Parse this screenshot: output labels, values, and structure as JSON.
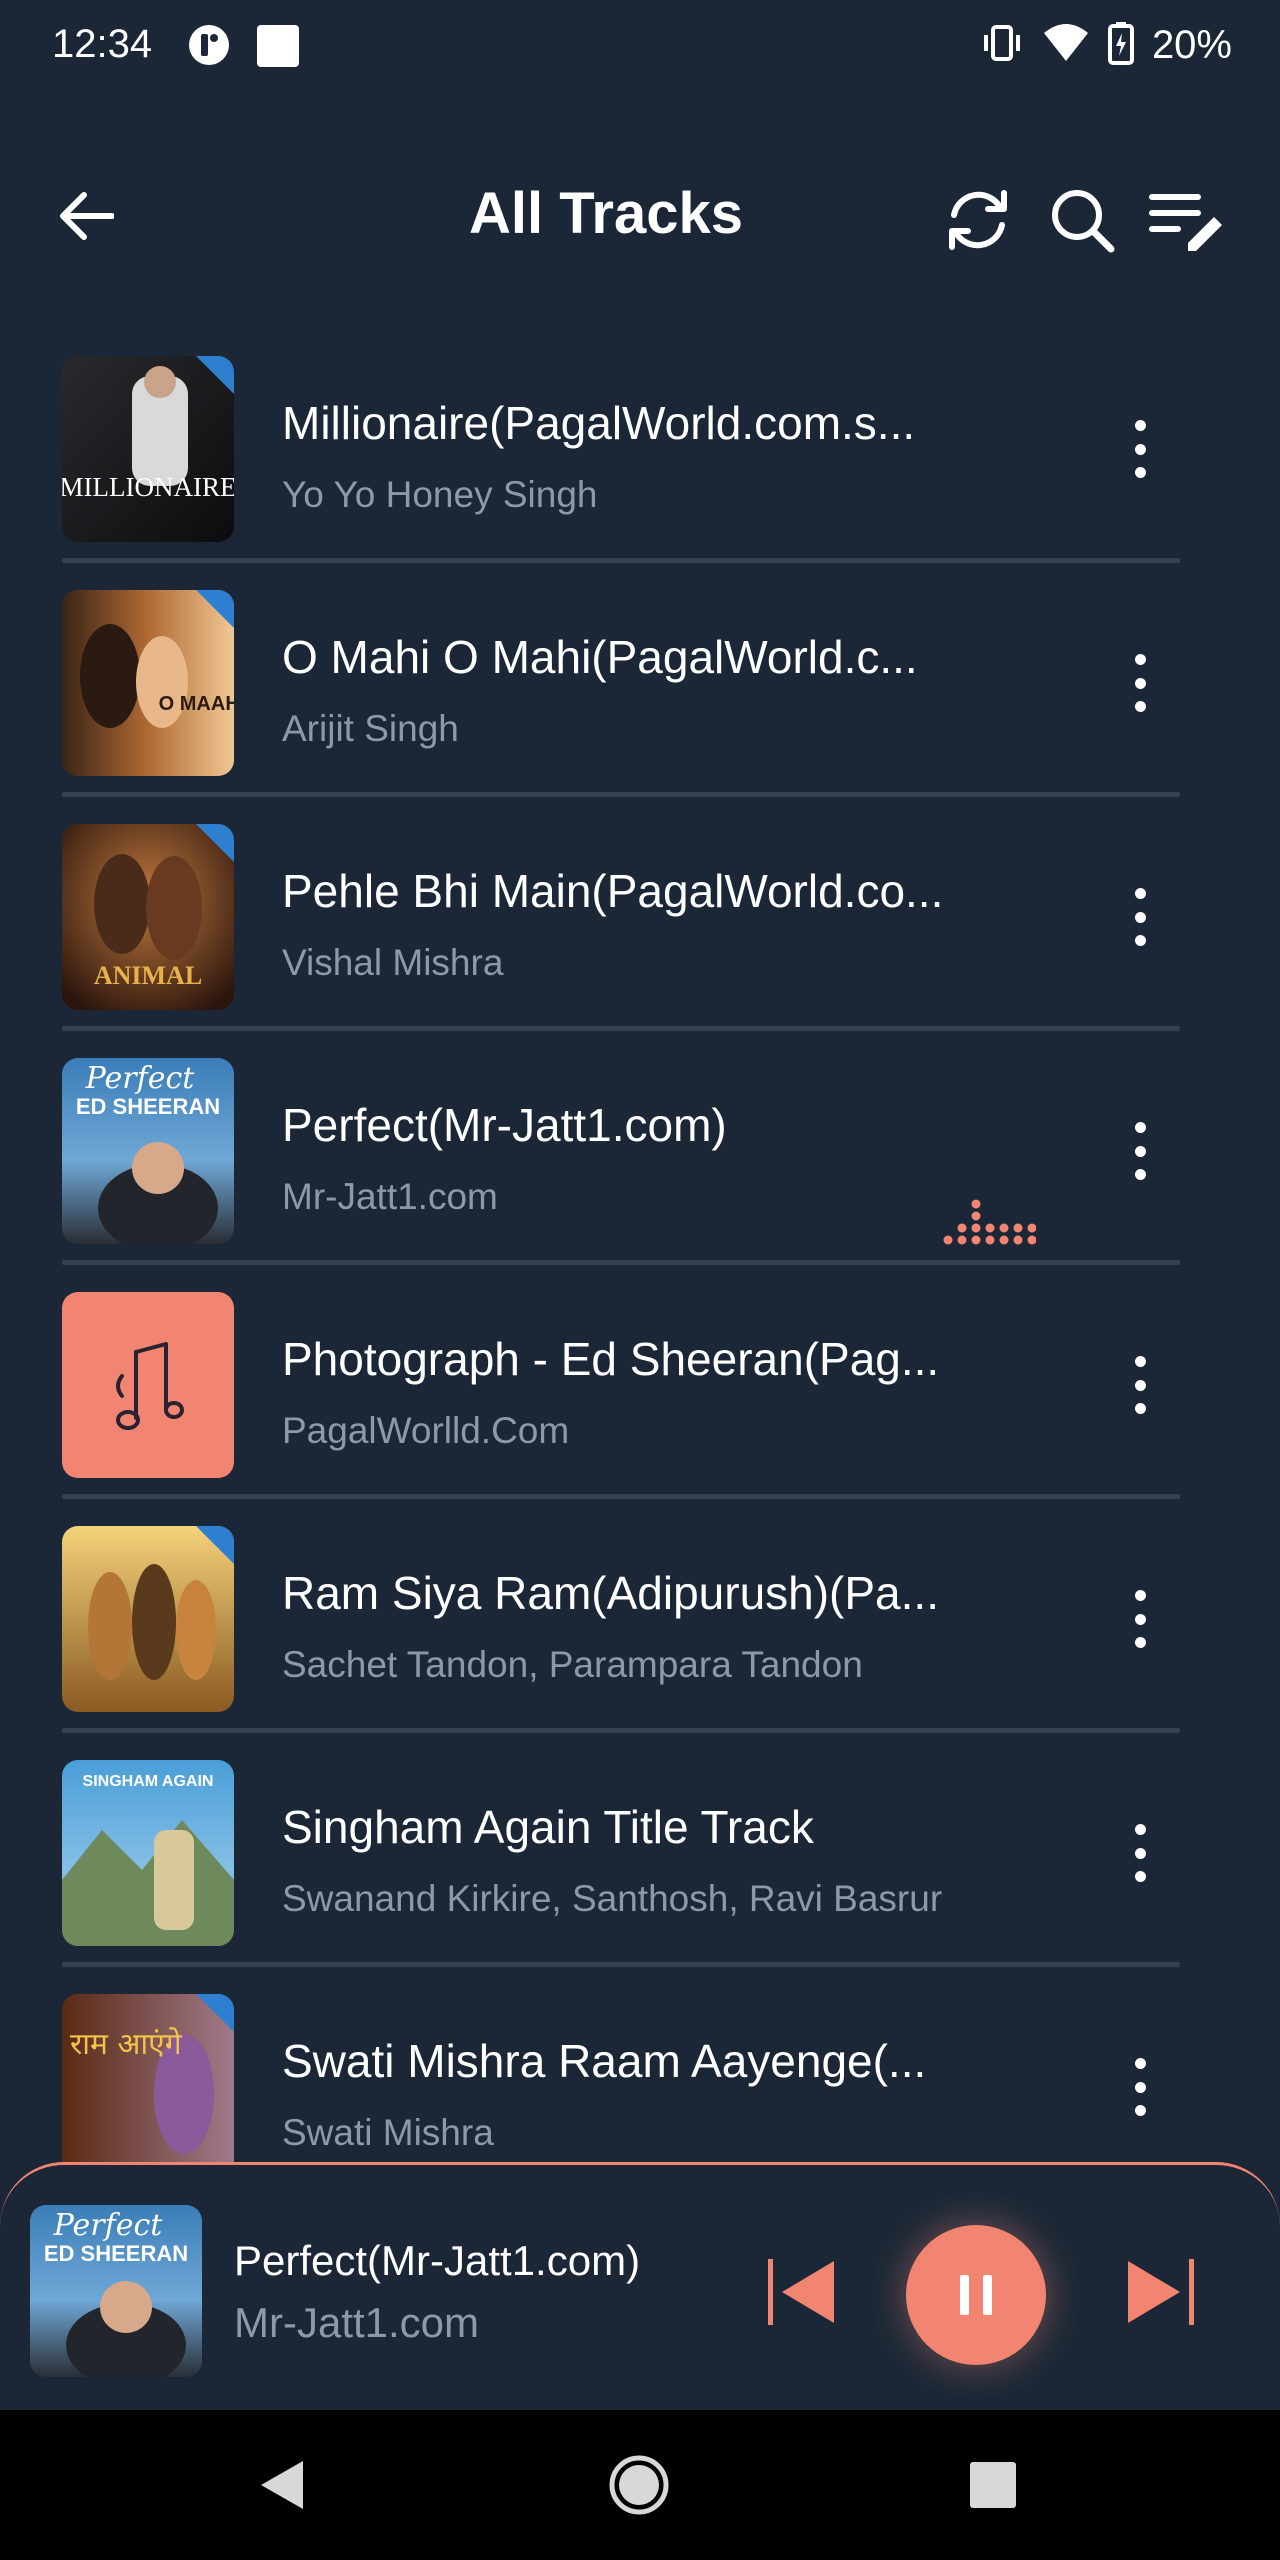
{
  "status_bar": {
    "time": "12:34",
    "battery": "20%",
    "icons": [
      "app-notification-icon",
      "square-notification-icon",
      "vibrate-icon",
      "wifi-icon",
      "battery-charging-icon"
    ]
  },
  "header": {
    "title": "All Tracks",
    "icons": [
      "back-arrow-icon",
      "refresh-icon",
      "search-icon",
      "edit-playlist-icon"
    ]
  },
  "tracks": [
    {
      "title": "Millionaire(PagalWorld.com.s...",
      "artist": "Yo Yo Honey Singh",
      "art_text": "MILLIONAIRE"
    },
    {
      "title": "O Mahi O Mahi(PagalWorld.c...",
      "artist": "Arijit Singh",
      "art_text": "O MAAHI"
    },
    {
      "title": "Pehle Bhi Main(PagalWorld.co...",
      "artist": "Vishal Mishra",
      "art_text": "ANIMAL"
    },
    {
      "title": "Perfect(Mr-Jatt1.com)",
      "artist": "Mr-Jatt1.com",
      "art_text": "ED SHEERAN",
      "art_script": "Perfect",
      "playing": true
    },
    {
      "title": "Photograph - Ed Sheeran(Pag...",
      "artist": "PagalWorlld.Com",
      "art_icon": "music-note-icon"
    },
    {
      "title": "Ram Siya Ram(Adipurush)(Pa...",
      "artist": "Sachet Tandon, Parampara Tandon"
    },
    {
      "title": "Singham Again Title Track",
      "artist": "Swanand Kirkire, Santhosh, Ravi Basrur",
      "art_text": "SINGHAM AGAIN"
    },
    {
      "title": "Swati Mishra Raam Aayenge(...",
      "artist": "Swati Mishra",
      "art_text": "राम आएंगे"
    }
  ],
  "mini_player": {
    "title": "Perfect(Mr-Jatt1.com)",
    "artist": "Mr-Jatt1.com",
    "art_script": "Perfect",
    "art_text": "ED SHEERAN",
    "state": "playing"
  },
  "colors": {
    "background": "#1b2736",
    "accent": "#f28571",
    "secondary_text": "#8e99a6",
    "divider": "#34414f"
  }
}
